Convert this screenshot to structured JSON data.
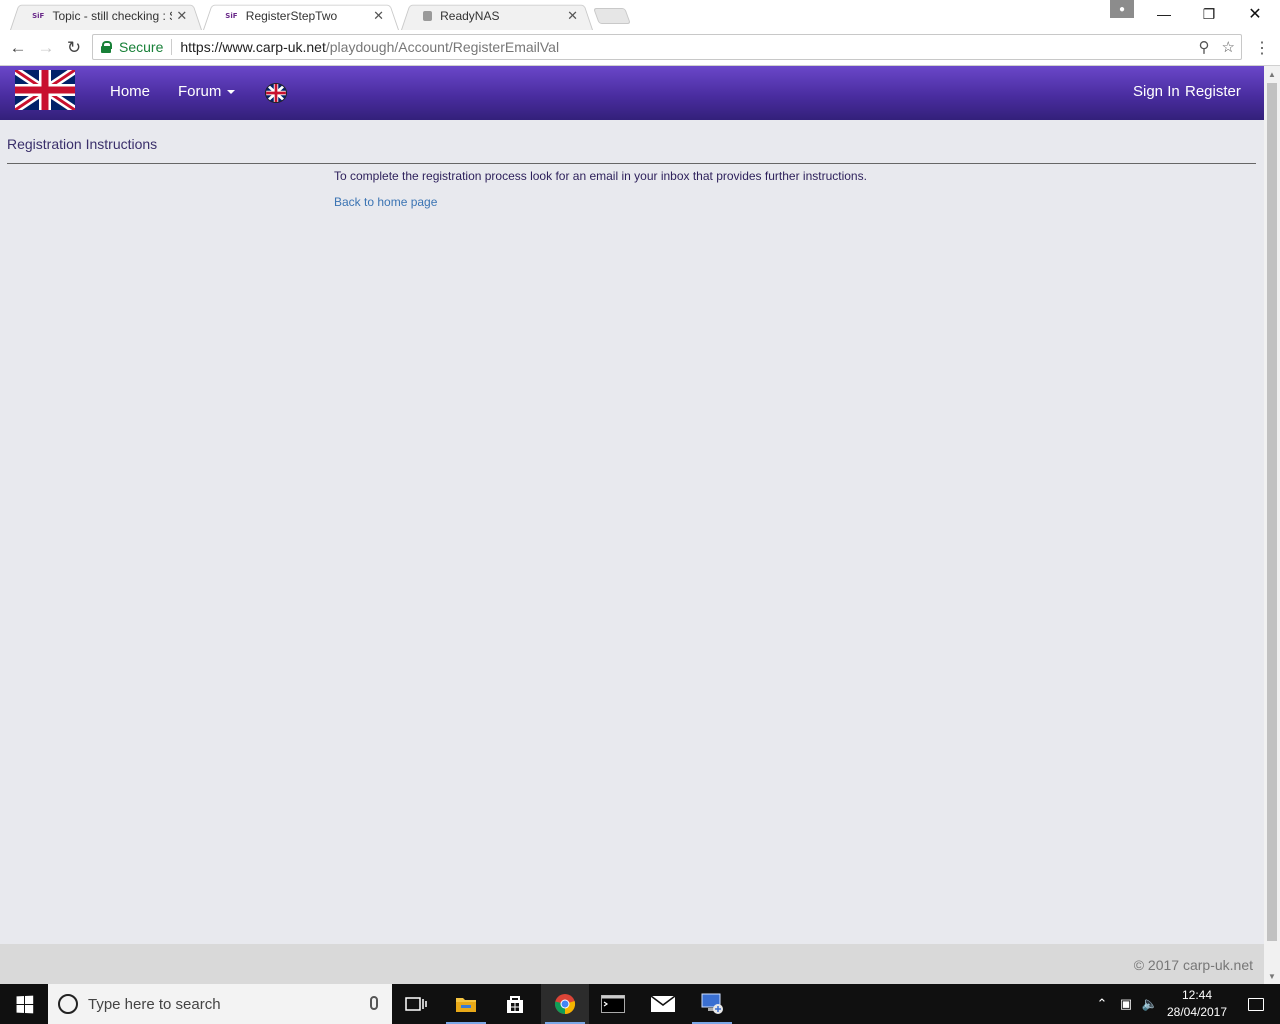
{
  "browser": {
    "tabs": [
      {
        "title": "Topic - still checking : Sn",
        "favicon": "SiF",
        "active": false
      },
      {
        "title": "RegisterStepTwo",
        "favicon": "SiF",
        "active": true
      },
      {
        "title": "ReadyNAS",
        "favicon": "",
        "active": false
      }
    ],
    "omnibox": {
      "secure_label": "Secure",
      "url_host": "https://www.carp-uk.net",
      "url_path": "/playdough/Account/RegisterEmailVal"
    }
  },
  "site": {
    "nav": {
      "home": "Home",
      "forum": "Forum",
      "sign_in": "Sign In",
      "register": "Register"
    },
    "page_title": "Registration Instructions",
    "instructions": "To complete the registration process look for an email in your inbox that provides further instructions.",
    "back_link": "Back to home page",
    "footer": "© 2017 carp-uk.net"
  },
  "taskbar": {
    "search_placeholder": "Type here to search",
    "time": "12:44",
    "date": "28/04/2017"
  }
}
